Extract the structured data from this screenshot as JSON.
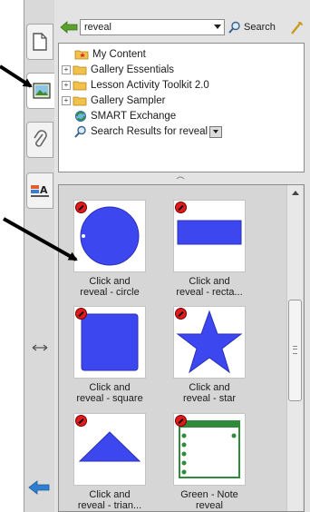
{
  "search": {
    "value": "reveal",
    "button_label": "Search"
  },
  "tree": {
    "items": [
      {
        "label": "My Content",
        "icon": "my-content-folder-icon",
        "expandable": false
      },
      {
        "label": "Gallery Essentials",
        "icon": "folder-icon",
        "expandable": true
      },
      {
        "label": "Lesson Activity Toolkit 2.0",
        "icon": "folder-icon",
        "expandable": true
      },
      {
        "label": "Gallery Sampler",
        "icon": "folder-icon",
        "expandable": true
      },
      {
        "label": "SMART Exchange",
        "icon": "exchange-globe-icon",
        "expandable": false
      },
      {
        "label": "Search Results for reveal",
        "icon": "search-icon",
        "expandable": false
      }
    ]
  },
  "gallery": {
    "items": [
      {
        "line1": "Click and",
        "line2": "reveal - circle",
        "shape": "circle"
      },
      {
        "line1": "Click and",
        "line2": "reveal - recta...",
        "shape": "rectangle"
      },
      {
        "line1": "Click and",
        "line2": "reveal - square",
        "shape": "square"
      },
      {
        "line1": "Click and",
        "line2": "reveal - star",
        "shape": "star"
      },
      {
        "line1": "Click and",
        "line2": "reveal - trian...",
        "shape": "triangle"
      },
      {
        "line1": "Green - Note",
        "line2": "reveal",
        "shape": "note"
      }
    ]
  },
  "tabs": [
    "page-sorter-tab",
    "gallery-tab",
    "attachments-tab",
    "properties-tab"
  ],
  "colors": {
    "shape_blue": "#3d47f0",
    "badge_red": "#e11b1b",
    "note_green": "#2f8a3a",
    "panel_bg": "#e3e3e3",
    "arrow_blue": "#2f7fd0"
  }
}
